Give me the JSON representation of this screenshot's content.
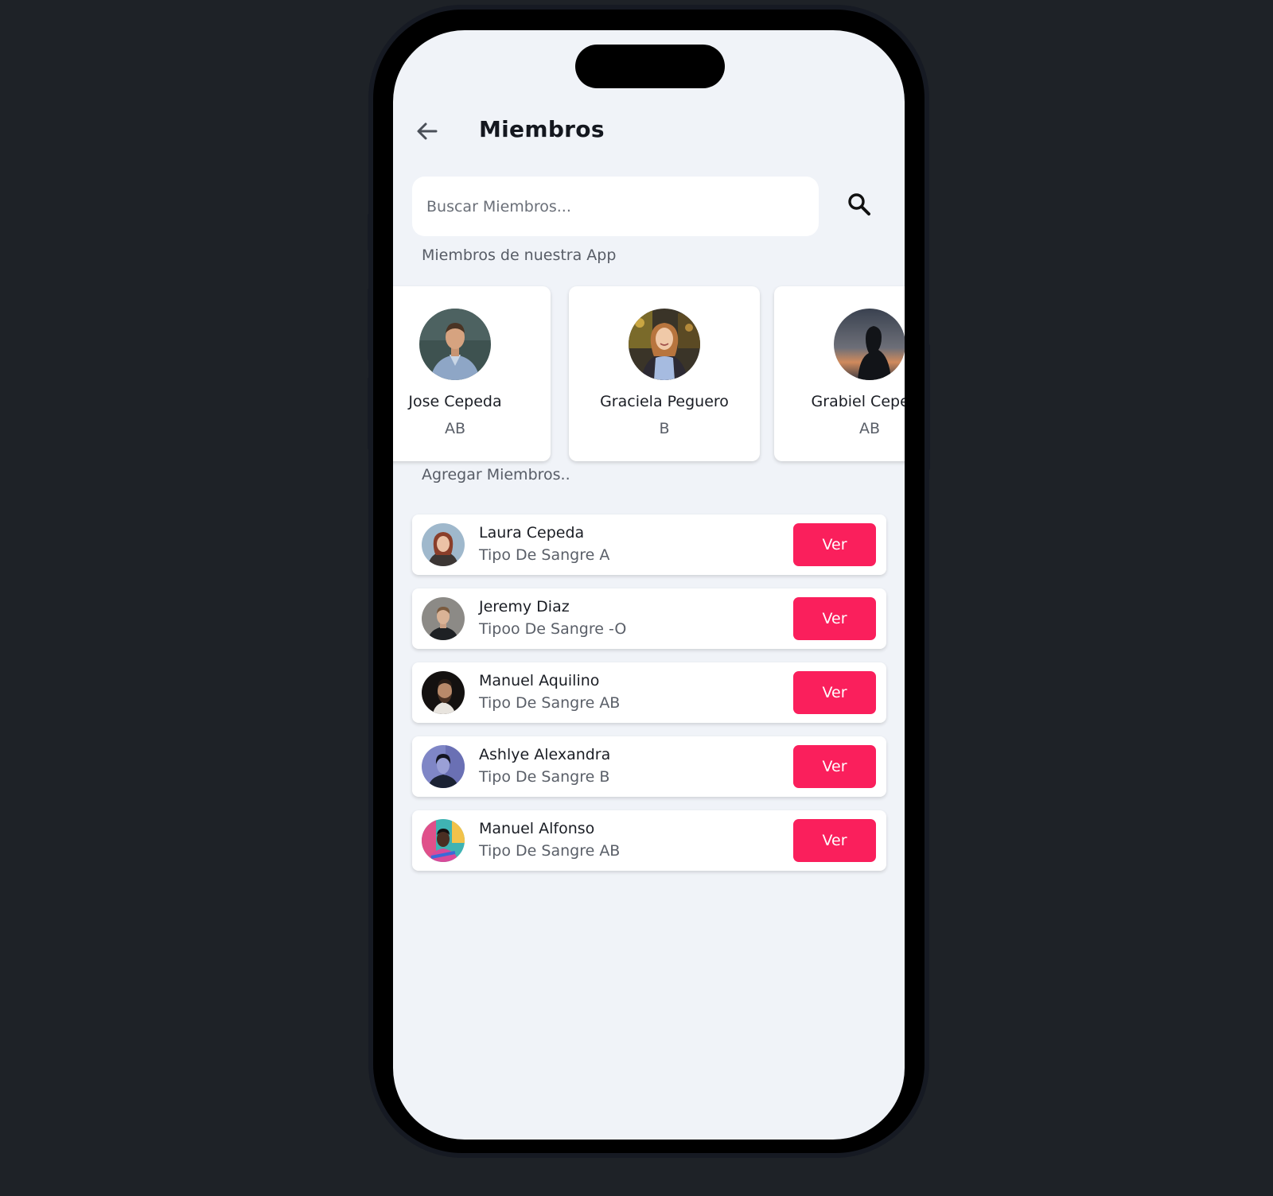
{
  "header": {
    "title": "Miembros",
    "back_icon": "arrow-left-icon"
  },
  "search": {
    "placeholder": "Buscar Miembros...",
    "value": "",
    "icon": "search-icon"
  },
  "featured": {
    "label": "Miembros de nuestra App",
    "members": [
      {
        "name": "Jose Cepeda",
        "blood": "AB"
      },
      {
        "name": "Graciela Peguero",
        "blood": "B"
      },
      {
        "name": "Grabiel Cepeda",
        "blood": "AB"
      }
    ]
  },
  "list": {
    "label": "Agregar Miembros..",
    "button_label": "Ver",
    "items": [
      {
        "name": "Laura Cepeda",
        "blood": "Tipo De Sangre A"
      },
      {
        "name": "Jeremy Diaz",
        "blood": "Tipoo De Sangre -O"
      },
      {
        "name": "Manuel Aquilino",
        "blood": "Tipo De Sangre AB"
      },
      {
        "name": "Ashlye Alexandra",
        "blood": "Tipo De Sangre B"
      },
      {
        "name": "Manuel Alfonso",
        "blood": "Tipo De Sangre AB"
      }
    ]
  },
  "colors": {
    "accent": "#fa1f5c",
    "screen_bg": "#f0f3f8",
    "page_bg": "#1e2227"
  }
}
